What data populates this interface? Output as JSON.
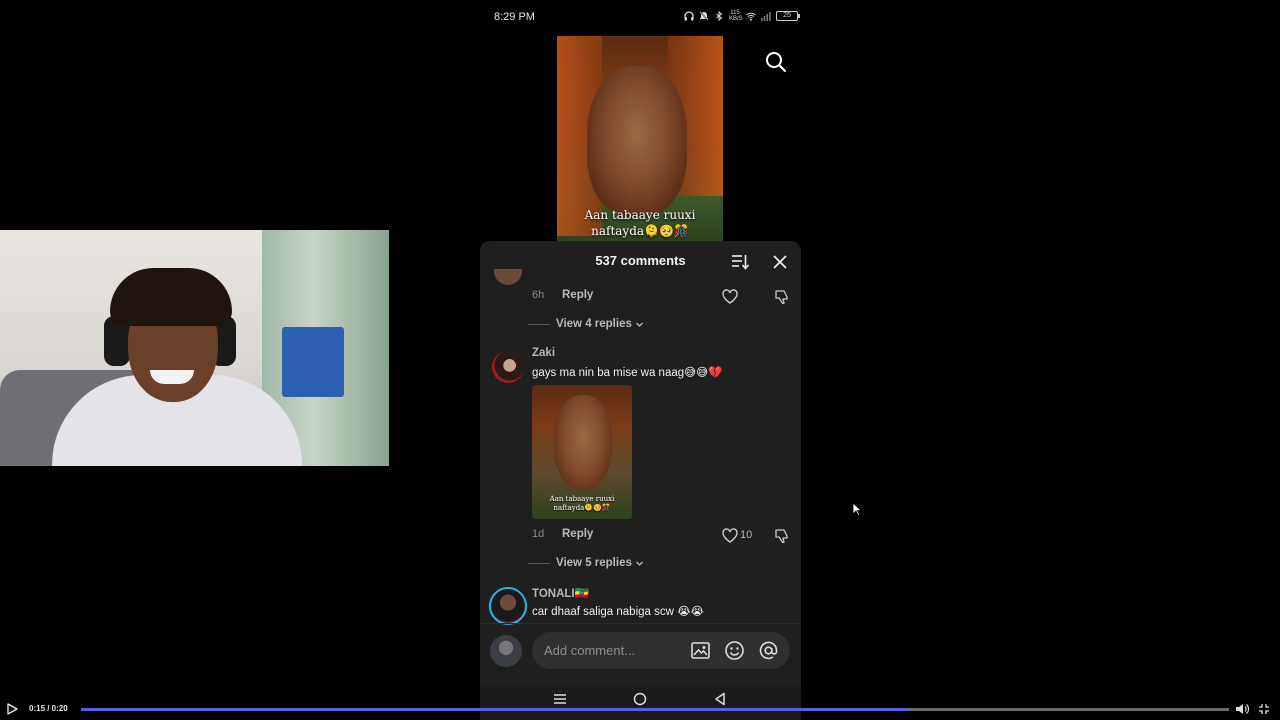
{
  "status_bar": {
    "time": "8:29 PM",
    "network_speed": "115 KB/S",
    "battery": "25",
    "icons": [
      "headphones-icon",
      "mute-icon",
      "bluetooth-icon",
      "wifi-icon",
      "signal-icon",
      "battery-icon"
    ]
  },
  "video": {
    "caption_line1": "Aan tabaaye ruuxi",
    "caption_line2": "naftayda🫠🥺🎊"
  },
  "comments_panel": {
    "title": "537 comments",
    "comments": [
      {
        "age": "6h",
        "reply_label": "Reply",
        "view_replies": "View 4 replies"
      },
      {
        "username": "Zaki",
        "text": "gays ma nin ba mise wa naag😅😅💔",
        "image_caption_line1": "Aan tabaaye ruuxi",
        "image_caption_line2": "naftayda🫠🥺🎊",
        "age": "1d",
        "reply_label": "Reply",
        "likes": "10",
        "view_replies": "View 5 replies"
      },
      {
        "username": "TONALI🇪🇹",
        "text": "car dhaaf saliga nabiga scw 😭😭"
      }
    ],
    "input_placeholder": "Add comment..."
  },
  "player": {
    "time": "0:15 / 0:20",
    "progress_fraction": 0.72,
    "accent_color": "#5a5de6"
  }
}
